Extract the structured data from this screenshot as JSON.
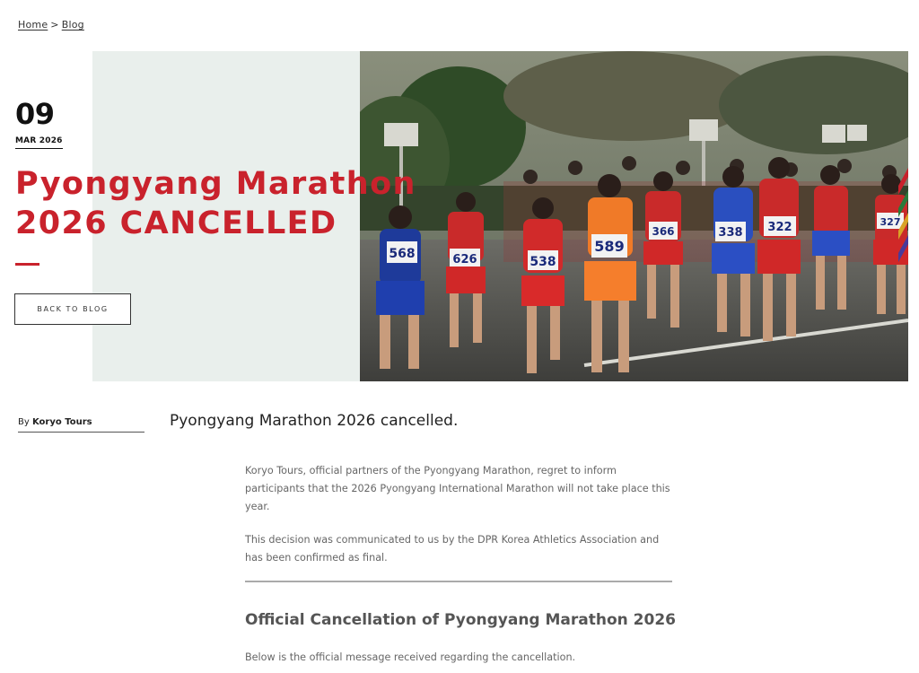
{
  "breadcrumb": {
    "home": "Home",
    "separator": ">",
    "blog": "Blog"
  },
  "post": {
    "day": "09",
    "month_year": "MAR 2026",
    "title_line1": "Pyongyang Marathon",
    "title_line2": "2026 CANCELLED",
    "back_label": "BACK TO BLOG",
    "by_prefix": "By",
    "author": "Koryo Tours",
    "lead": "Pyongyang Marathon 2026 cancelled.",
    "paragraphs": [
      "Koryo Tours, official partners of the Pyongyang Marathon, regret to inform participants that the 2026 Pyongyang International Marathon will not take place this year.",
      "This decision was communicated to us by the DPR Korea Athletics Association and has been confirmed as final."
    ],
    "section_heading": "Official Cancellation of Pyongyang Marathon 2026",
    "section_intro": "Below is the official message received regarding the cancellation."
  },
  "photo": {
    "bibs": [
      "568",
      "626",
      "538",
      "589",
      "366",
      "338",
      "322",
      "327"
    ]
  },
  "colors": {
    "accent": "#c9222c",
    "panel": "#e9efec"
  }
}
